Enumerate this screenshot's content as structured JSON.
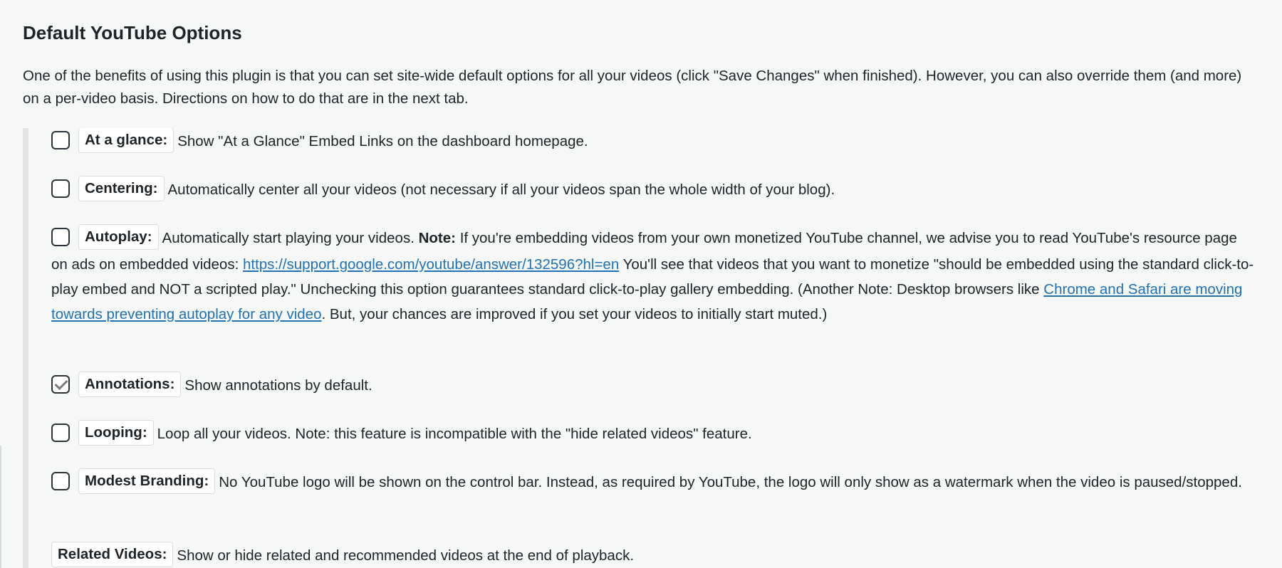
{
  "section": {
    "title": "Default YouTube Options",
    "intro": "One of the benefits of using this plugin is that you can set site-wide default options for all your videos (click \"Save Changes\" when finished). However, you can also override them (and more) on a per-video basis. Directions on how to do that are in the next tab."
  },
  "options": {
    "at_a_glance": {
      "label": "At a glance:",
      "description": "Show \"At a Glance\" Embed Links on the dashboard homepage.",
      "checked": false
    },
    "centering": {
      "label": "Centering:",
      "description": "Automatically center all your videos (not necessary if all your videos span the whole width of your blog).",
      "checked": false
    },
    "autoplay": {
      "label": "Autoplay:",
      "text1": "Automatically start playing your videos.",
      "note_label": "Note:",
      "text2": "If you're embedding videos from your own monetized YouTube channel, we advise you to read YouTube's resource page on ads on embedded videos:",
      "link1": "https://support.google.com/youtube/answer/132596?hl=en",
      "text3": "You'll see that videos that you want to monetize \"should be embedded using the standard click-to-play embed and NOT a scripted play.\" Unchecking this option guarantees standard click-to-play gallery embedding. (Another Note: Desktop browsers like",
      "link2": "Chrome and Safari are moving towards preventing autoplay for any video",
      "text4": ". But, your chances are improved if you set your videos to initially start muted.)",
      "checked": false
    },
    "annotations": {
      "label": "Annotations:",
      "description": "Show annotations by default.",
      "checked": true
    },
    "looping": {
      "label": "Looping:",
      "description": "Loop all your videos. Note: this feature is incompatible with the \"hide related videos\" feature.",
      "checked": false
    },
    "modest_branding": {
      "label": "Modest Branding:",
      "description": "No YouTube logo will be shown on the control bar. Instead, as required by YouTube, the logo will only show as a watermark when the video is paused/stopped.",
      "checked": false
    },
    "related_videos": {
      "label": "Related Videos:",
      "description": "Show or hide related and recommended videos at the end of playback."
    }
  },
  "colors": {
    "background": "#f6f7f7",
    "text": "#1d2327",
    "link": "#2271b1",
    "rule": "#e2e4e6"
  }
}
